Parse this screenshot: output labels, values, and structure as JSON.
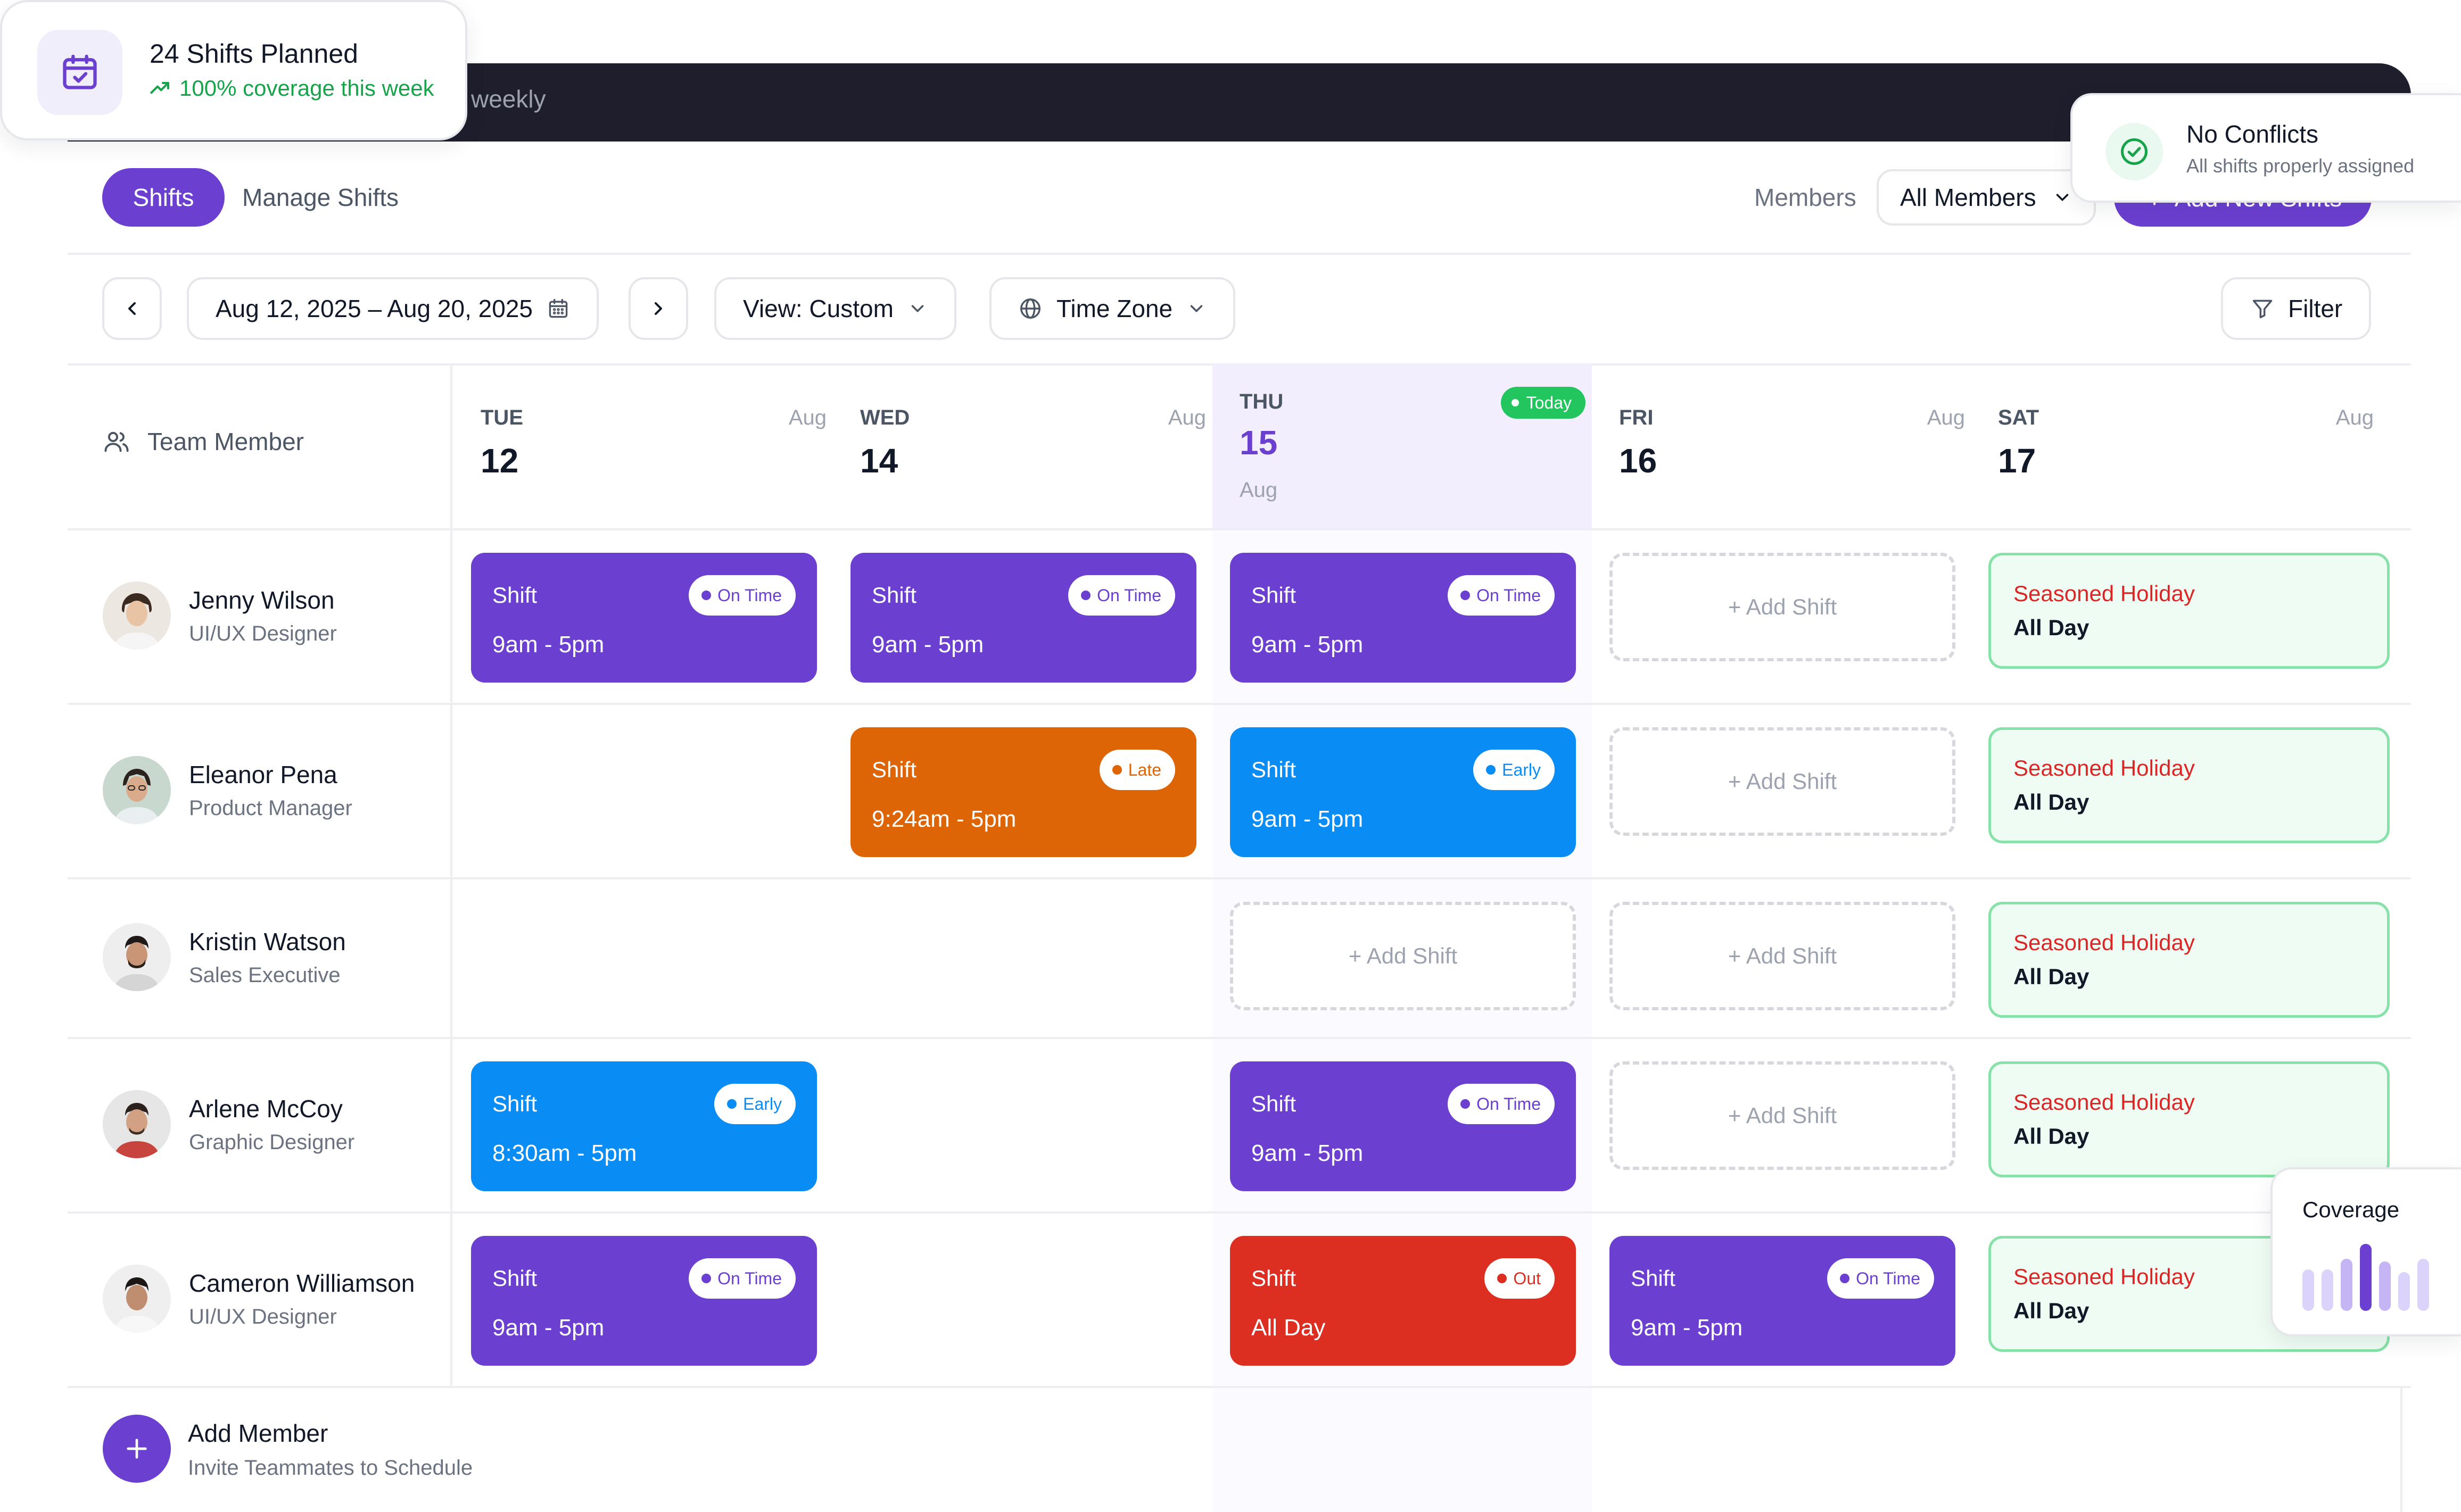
{
  "header": {
    "weekly_text": "weekly"
  },
  "stats_card": {
    "title": "24 Shifts Planned",
    "subtitle": "100% coverage this week"
  },
  "conflicts_card": {
    "title": "No Conflicts",
    "subtitle": "All shifts properly assigned"
  },
  "coverage_card": {
    "title": "Coverage",
    "levels": [
      0.62,
      0.62,
      0.78,
      1.0,
      0.74,
      0.58,
      0.78
    ],
    "colors": [
      "#dcd3fa",
      "#dcd3fa",
      "#c6b5f5",
      "#6b3fd0",
      "#c6b5f5",
      "#dcd3fa",
      "#dcd3fa"
    ]
  },
  "tabs": {
    "shifts": "Shifts",
    "manage": "Manage Shifts"
  },
  "members_filter": {
    "label": "Members",
    "value": "All Members"
  },
  "add_button": {
    "label": "Add New Shifts"
  },
  "toolbar": {
    "date_range": "Aug 12, 2025 – Aug 20, 2025",
    "view": "View: Custom",
    "timezone": "Time Zone",
    "filter": "Filter"
  },
  "calendar": {
    "team_header": "Team Member",
    "days": [
      {
        "dow": "TUE",
        "num": "12",
        "month": "Aug"
      },
      {
        "dow": "WED",
        "num": "14",
        "month": "Aug"
      },
      {
        "dow": "THU",
        "num": "15",
        "month": "Aug",
        "badge": "Today"
      },
      {
        "dow": "FRI",
        "num": "16",
        "month": "Aug"
      },
      {
        "dow": "SAT",
        "num": "17",
        "month": "Aug"
      }
    ],
    "members": [
      {
        "name": "Jenny Wilson",
        "role": "UI/UX Designer"
      },
      {
        "name": "Eleanor Pena",
        "role": "Product Manager"
      },
      {
        "name": "Kristin Watson",
        "role": "Sales Executive"
      },
      {
        "name": "Arlene McCoy",
        "role": "Graphic Designer"
      },
      {
        "name": "Cameron Williamson",
        "role": "UI/UX Designer"
      }
    ],
    "shift_label": "Shift",
    "add_shift": "+ Add Shift",
    "holiday": {
      "name": "Seasoned Holiday",
      "duration": "All Day"
    },
    "times": {
      "std": "9am - 5pm",
      "late": "9:24am - 5pm",
      "early": "8:30am - 5pm",
      "allday": "All Day"
    },
    "statuses": {
      "on_time": "On Time",
      "late": "Late",
      "early": "Early",
      "out": "Out"
    }
  },
  "add_member": {
    "title": "Add Member",
    "subtitle": "Invite Teammates to Schedule"
  }
}
